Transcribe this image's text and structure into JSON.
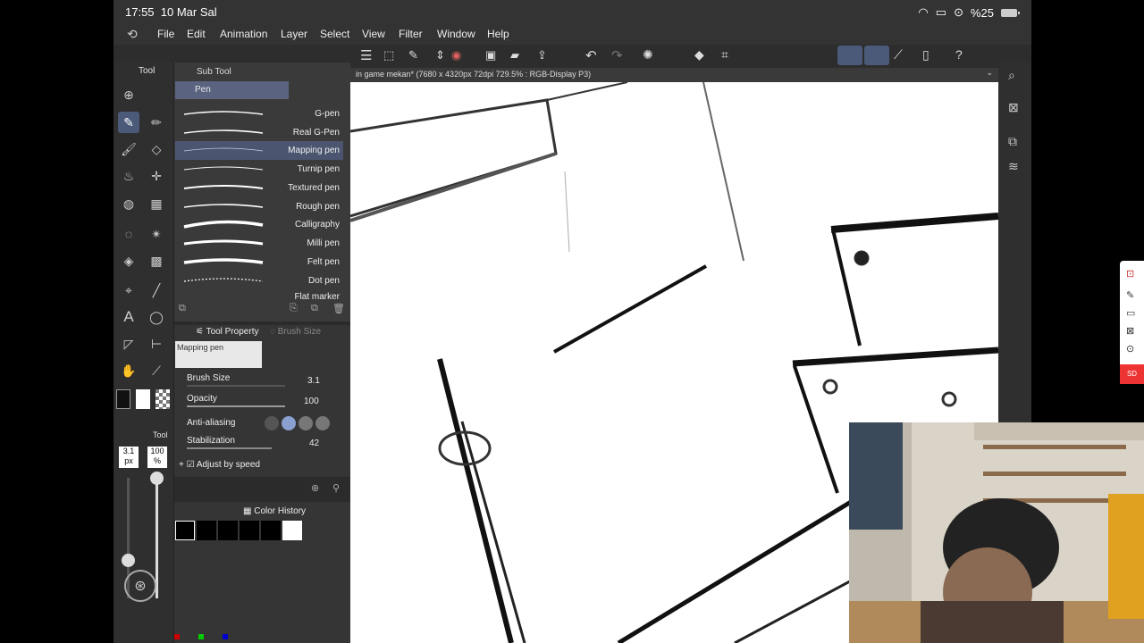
{
  "status": {
    "time": "17:55",
    "date": "10 Mar Sal",
    "battery": "%25"
  },
  "menu": [
    "File",
    "Edit",
    "Animation",
    "Layer",
    "Select",
    "View",
    "Filter",
    "Window",
    "Help"
  ],
  "tool_tabs": {
    "tool": "Tool",
    "sub_tool": "Sub Tool",
    "group": "Pen"
  },
  "pens": [
    "G-pen",
    "Real G-Pen",
    "Mapping pen",
    "Turnip pen",
    "Textured pen",
    "Rough pen",
    "Calligraphy",
    "Milli pen",
    "Felt pen",
    "Dot pen",
    "Flat marker"
  ],
  "selected_pen": "Mapping pen",
  "tool_property": {
    "tab": "Tool Property",
    "tab2": "Brush Size",
    "preset": "Mapping pen",
    "brush_size_label": "Brush Size",
    "brush_size": "3.1",
    "opacity_label": "Opacity",
    "opacity": "100",
    "antialias_label": "Anti-aliasing",
    "stab_label": "Stabilization",
    "stab": "42",
    "adjust_label": "Adjust by speed"
  },
  "color_history": {
    "title": "Color History"
  },
  "left_readout": {
    "size": "3.1",
    "size_unit": "px",
    "opacity": "100",
    "opacity_unit": "%",
    "tab": "Tool"
  },
  "canvas": {
    "title": "in game mekan* (7680 x 4320px 72dpi 729.5% : RGB-Display P3)"
  },
  "colors": {
    "accent": "#4a5a78",
    "selected": "#4c5570"
  },
  "icons": [
    "undo-icon",
    "redo-icon",
    "menu-icon",
    "layers-icon",
    "search-icon"
  ]
}
